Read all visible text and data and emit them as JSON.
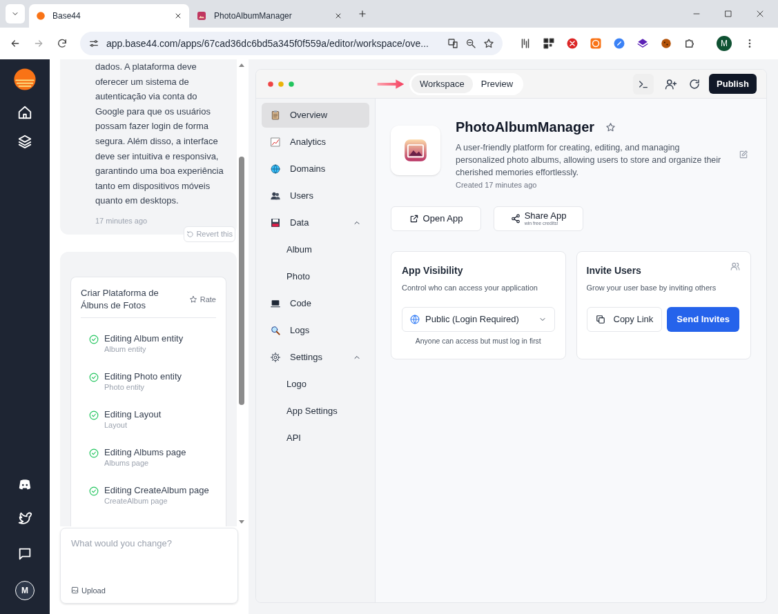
{
  "browser": {
    "tabs": [
      {
        "title": "Base44",
        "selected": true
      },
      {
        "title": "PhotoAlbumManager",
        "selected": false
      }
    ],
    "url": "app.base44.com/apps/67cad36dc6bd5a345f0f559a/editor/workspace/ove...",
    "profile_initial": "M"
  },
  "rail": {
    "avatar_initial": "M"
  },
  "chat": {
    "message": {
      "text": "dados. A plataforma deve oferecer um sistema de autenticação via conta do Google para que os usuários possam fazer login de forma segura. Além disso, a interface deve ser intuitiva e responsiva, garantindo uma boa experiência tanto em dispositivos móveis quanto em desktops.",
      "time": "17 minutes ago",
      "revert_label": "Revert this"
    },
    "task_card": {
      "title": "Criar Plataforma de Álbuns de Fotos",
      "rate_label": "Rate",
      "tasks": [
        {
          "title": "Editing Album entity",
          "subtitle": "Album entity",
          "done": true
        },
        {
          "title": "Editing Photo entity",
          "subtitle": "Photo entity",
          "done": true
        },
        {
          "title": "Editing Layout",
          "subtitle": "Layout",
          "done": true
        },
        {
          "title": "Editing Albums page",
          "subtitle": "Albums page",
          "done": true
        },
        {
          "title": "Editing CreateAlbum page",
          "subtitle": "CreateAlbum page",
          "done": true
        }
      ]
    },
    "composer": {
      "placeholder": "What would you change?",
      "upload_label": "Upload"
    }
  },
  "editor": {
    "view_tabs": [
      {
        "label": "Workspace",
        "selected": true
      },
      {
        "label": "Preview",
        "selected": false
      }
    ],
    "publish_label": "Publish",
    "nav": [
      {
        "label": "Overview",
        "selected": true
      },
      {
        "label": "Analytics",
        "selected": false
      },
      {
        "label": "Domains",
        "selected": false
      },
      {
        "label": "Users",
        "selected": false
      },
      {
        "label": "Data",
        "selected": false,
        "expanded": true,
        "children": [
          {
            "label": "Album",
            "selected": false
          },
          {
            "label": "Photo",
            "selected": false
          }
        ]
      },
      {
        "label": "Code",
        "selected": false
      },
      {
        "label": "Logs",
        "selected": false
      },
      {
        "label": "Settings",
        "selected": false,
        "expanded": true,
        "children": [
          {
            "label": "Logo",
            "selected": false
          },
          {
            "label": "App Settings",
            "selected": false
          },
          {
            "label": "API",
            "selected": false
          }
        ]
      }
    ],
    "app": {
      "name": "PhotoAlbumManager",
      "description": "A user-friendly platform for creating, editing, and managing personalized photo albums, allowing users to store and organize their cherished memories effortlessly.",
      "created": "Created 17 minutes ago",
      "open_label": "Open App",
      "share_label": "Share App",
      "share_sub": "win free credits!"
    },
    "visibility": {
      "title": "App Visibility",
      "subtitle": "Control who can access your application",
      "value": "Public (Login Required)",
      "note": "Anyone can access but must log in first"
    },
    "invite": {
      "title": "Invite Users",
      "subtitle": "Grow your user base by inviting others",
      "copy_label": "Copy Link",
      "send_label": "Send Invites"
    }
  }
}
